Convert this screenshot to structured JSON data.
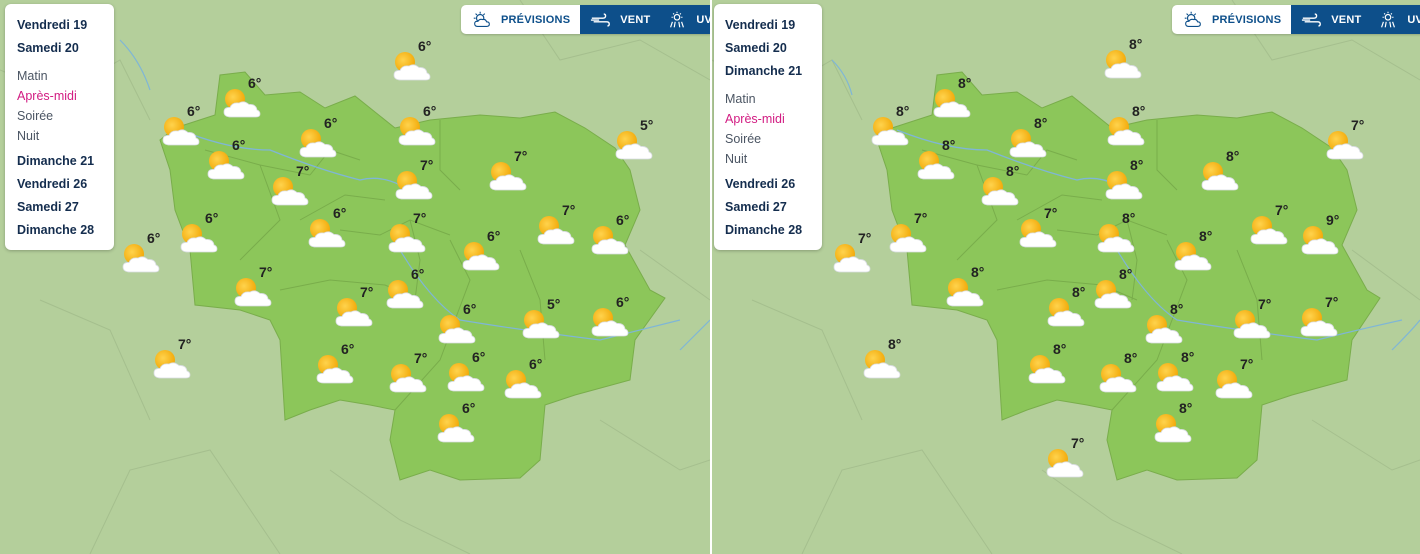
{
  "colors": {
    "map_background": "#b4cf9b",
    "region_fill": "#8cc65a",
    "toolbar_active": "#0d4f8a",
    "active_period": "#d21c82",
    "day_text": "#142d4e"
  },
  "left_panel": {
    "toolbar": {
      "previsions_label": "PRÉVISIONS",
      "previsions_icon": "sun-cloud-icon",
      "vent_label": "VENT",
      "vent_icon": "wind-icon",
      "uv_label": "UV",
      "uv_icon": "uv-sun-icon"
    },
    "days_top": [
      "Vendredi 19",
      "Samedi 20"
    ],
    "periods": [
      {
        "label": "Matin",
        "active": false
      },
      {
        "label": "Après-midi",
        "active": true
      },
      {
        "label": "Soirée",
        "active": false
      },
      {
        "label": "Nuit",
        "active": false
      }
    ],
    "days_bottom": [
      "Dimanche 21",
      "Vendredi 26",
      "Samedi 27",
      "Dimanche 28"
    ],
    "markers": [
      {
        "temp": "6°",
        "icon": "sun-cloud-icon"
      },
      {
        "temp": "6°",
        "icon": "sun-cloud-icon"
      },
      {
        "temp": "6°",
        "icon": "sun-cloud-icon"
      },
      {
        "temp": "6°",
        "icon": "sun-cloud-icon"
      },
      {
        "temp": "6°",
        "icon": "sun-cloud-icon"
      },
      {
        "temp": "5°",
        "icon": "sun-cloud-icon"
      },
      {
        "temp": "6°",
        "icon": "sun-cloud-icon"
      },
      {
        "temp": "7°",
        "icon": "sun-cloud-icon"
      },
      {
        "temp": "7°",
        "icon": "sun-cloud-icon"
      },
      {
        "temp": "7°",
        "icon": "sun-cloud-icon"
      },
      {
        "temp": "6°",
        "icon": "sun-cloud-icon"
      },
      {
        "temp": "7°",
        "icon": "sun-cloud-icon"
      },
      {
        "temp": "6°",
        "icon": "sun-cloud-icon"
      },
      {
        "temp": "6°",
        "icon": "sun-cloud-icon"
      },
      {
        "temp": "6°",
        "icon": "sun-cloud-icon"
      },
      {
        "temp": "7°",
        "icon": "sun-cloud-icon"
      },
      {
        "temp": "6°",
        "icon": "sun-cloud-icon"
      },
      {
        "temp": "7°",
        "icon": "sun-cloud-icon"
      },
      {
        "temp": "6°",
        "icon": "sun-cloud-icon"
      },
      {
        "temp": "7°",
        "icon": "sun-cloud-icon"
      },
      {
        "temp": "6°",
        "icon": "sun-cloud-icon"
      },
      {
        "temp": "5°",
        "icon": "sun-cloud-icon"
      },
      {
        "temp": "6°",
        "icon": "sun-cloud-icon"
      },
      {
        "temp": "7°",
        "icon": "sun-cloud-icon"
      },
      {
        "temp": "6°",
        "icon": "sun-cloud-icon"
      },
      {
        "temp": "7°",
        "icon": "sun-cloud-icon"
      },
      {
        "temp": "6°",
        "icon": "sun-cloud-icon"
      },
      {
        "temp": "6°",
        "icon": "sun-cloud-icon"
      },
      {
        "temp": "6°",
        "icon": "sun-cloud-icon"
      }
    ]
  },
  "right_panel": {
    "toolbar": {
      "previsions_label": "PRÉVISIONS",
      "previsions_icon": "sun-cloud-icon",
      "vent_label": "VENT",
      "vent_icon": "wind-icon",
      "uv_label": "UV",
      "uv_icon": "uv-sun-icon"
    },
    "days_top": [
      "Vendredi 19",
      "Samedi 20",
      "Dimanche 21"
    ],
    "periods": [
      {
        "label": "Matin",
        "active": false
      },
      {
        "label": "Après-midi",
        "active": true
      },
      {
        "label": "Soirée",
        "active": false
      },
      {
        "label": "Nuit",
        "active": false
      }
    ],
    "days_bottom": [
      "Vendredi 26",
      "Samedi 27",
      "Dimanche 28"
    ],
    "markers": [
      {
        "temp": "8°",
        "icon": "sun-cloud-icon"
      },
      {
        "temp": "8°",
        "icon": "sun-cloud-icon"
      },
      {
        "temp": "8°",
        "icon": "sun-cloud-icon"
      },
      {
        "temp": "8°",
        "icon": "sun-cloud-icon"
      },
      {
        "temp": "8°",
        "icon": "sun-cloud-icon"
      },
      {
        "temp": "7°",
        "icon": "sun-cloud-icon"
      },
      {
        "temp": "8°",
        "icon": "sun-cloud-icon"
      },
      {
        "temp": "8°",
        "icon": "sun-cloud-icon"
      },
      {
        "temp": "8°",
        "icon": "sun-cloud-icon"
      },
      {
        "temp": "8°",
        "icon": "sun-cloud-icon"
      },
      {
        "temp": "7°",
        "icon": "sun-cloud-icon"
      },
      {
        "temp": "7°",
        "icon": "sun-cloud-icon"
      },
      {
        "temp": "9°",
        "icon": "sun-cloud-icon"
      },
      {
        "temp": "7°",
        "icon": "sun-cloud-icon"
      },
      {
        "temp": "7°",
        "icon": "sun-cloud-icon"
      },
      {
        "temp": "8°",
        "icon": "sun-cloud-icon"
      },
      {
        "temp": "8°",
        "icon": "sun-cloud-icon"
      },
      {
        "temp": "8°",
        "icon": "sun-cloud-icon"
      },
      {
        "temp": "8°",
        "icon": "sun-cloud-icon"
      },
      {
        "temp": "8°",
        "icon": "sun-cloud-icon"
      },
      {
        "temp": "8°",
        "icon": "sun-cloud-icon"
      },
      {
        "temp": "7°",
        "icon": "sun-cloud-icon"
      },
      {
        "temp": "7°",
        "icon": "sun-cloud-icon"
      },
      {
        "temp": "8°",
        "icon": "sun-cloud-icon"
      },
      {
        "temp": "8°",
        "icon": "sun-cloud-icon"
      },
      {
        "temp": "8°",
        "icon": "sun-cloud-icon"
      },
      {
        "temp": "8°",
        "icon": "sun-cloud-icon"
      },
      {
        "temp": "7°",
        "icon": "sun-cloud-icon"
      },
      {
        "temp": "8°",
        "icon": "sun-cloud-icon"
      },
      {
        "temp": "7°",
        "icon": "sun-cloud-icon"
      }
    ]
  }
}
